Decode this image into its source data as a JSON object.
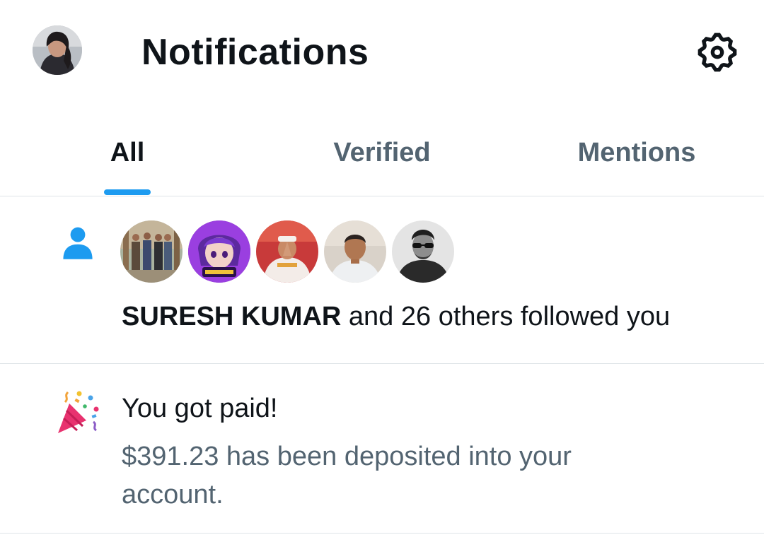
{
  "header": {
    "title": "Notifications",
    "profile_avatar_icon": "user-avatar-photo",
    "settings_icon": "gear-icon"
  },
  "tabs": [
    {
      "label": "All",
      "active": true
    },
    {
      "label": "Verified",
      "active": false
    },
    {
      "label": "Mentions",
      "active": false
    }
  ],
  "notifications": [
    {
      "type": "follow",
      "icon": "person-icon",
      "avatars": [
        "group-photo",
        "game-character",
        "man-namaste",
        "man-portrait",
        "man-sunglasses"
      ],
      "actor": "SURESH KUMAR",
      "text": " and 26 others followed you"
    },
    {
      "type": "payment",
      "icon": "party-popper-icon",
      "title": "You got paid!",
      "body": "$391.23 has been deposited into your account."
    }
  ],
  "colors": {
    "accent": "#1d9bf0",
    "text_primary": "#0f1419",
    "text_secondary": "#536471",
    "divider": "#dfe4e8"
  }
}
